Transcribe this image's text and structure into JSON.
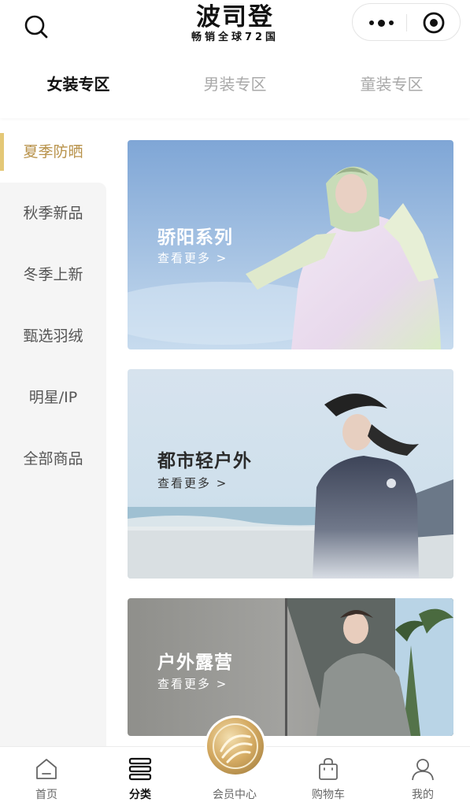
{
  "header": {
    "logo_main": "波司登",
    "logo_sub": "畅销全球72国"
  },
  "tabs": [
    {
      "label": "女装专区",
      "active": true
    },
    {
      "label": "男装专区",
      "active": false
    },
    {
      "label": "童装专区",
      "active": false
    }
  ],
  "sidebar": {
    "items": [
      {
        "label": "夏季防晒",
        "active": true
      },
      {
        "label": "秋季新品",
        "active": false
      },
      {
        "label": "冬季上新",
        "active": false
      },
      {
        "label": "甄选羽绒",
        "active": false
      },
      {
        "label": "明星/IP",
        "active": false
      },
      {
        "label": "全部商品",
        "active": false
      }
    ]
  },
  "cards": [
    {
      "title": "骄阳系列",
      "more": "查看更多 >"
    },
    {
      "title": "都市轻户外",
      "more": "查看更多 >"
    },
    {
      "title": "户外露营",
      "more": "查看更多 >"
    }
  ],
  "bottom_nav": [
    {
      "label": "首页",
      "icon": "home-icon",
      "active": false
    },
    {
      "label": "分类",
      "icon": "category-icon",
      "active": true
    },
    {
      "label": "会员中心",
      "icon": "member-center-icon",
      "active": false
    },
    {
      "label": "购物车",
      "icon": "shopping-bag-icon",
      "active": false
    },
    {
      "label": "我的",
      "icon": "profile-icon",
      "active": false
    }
  ],
  "colors": {
    "accent_gold": "#b8924a",
    "indicator": "#e4c877",
    "sidebar_bg": "#f5f5f5"
  }
}
